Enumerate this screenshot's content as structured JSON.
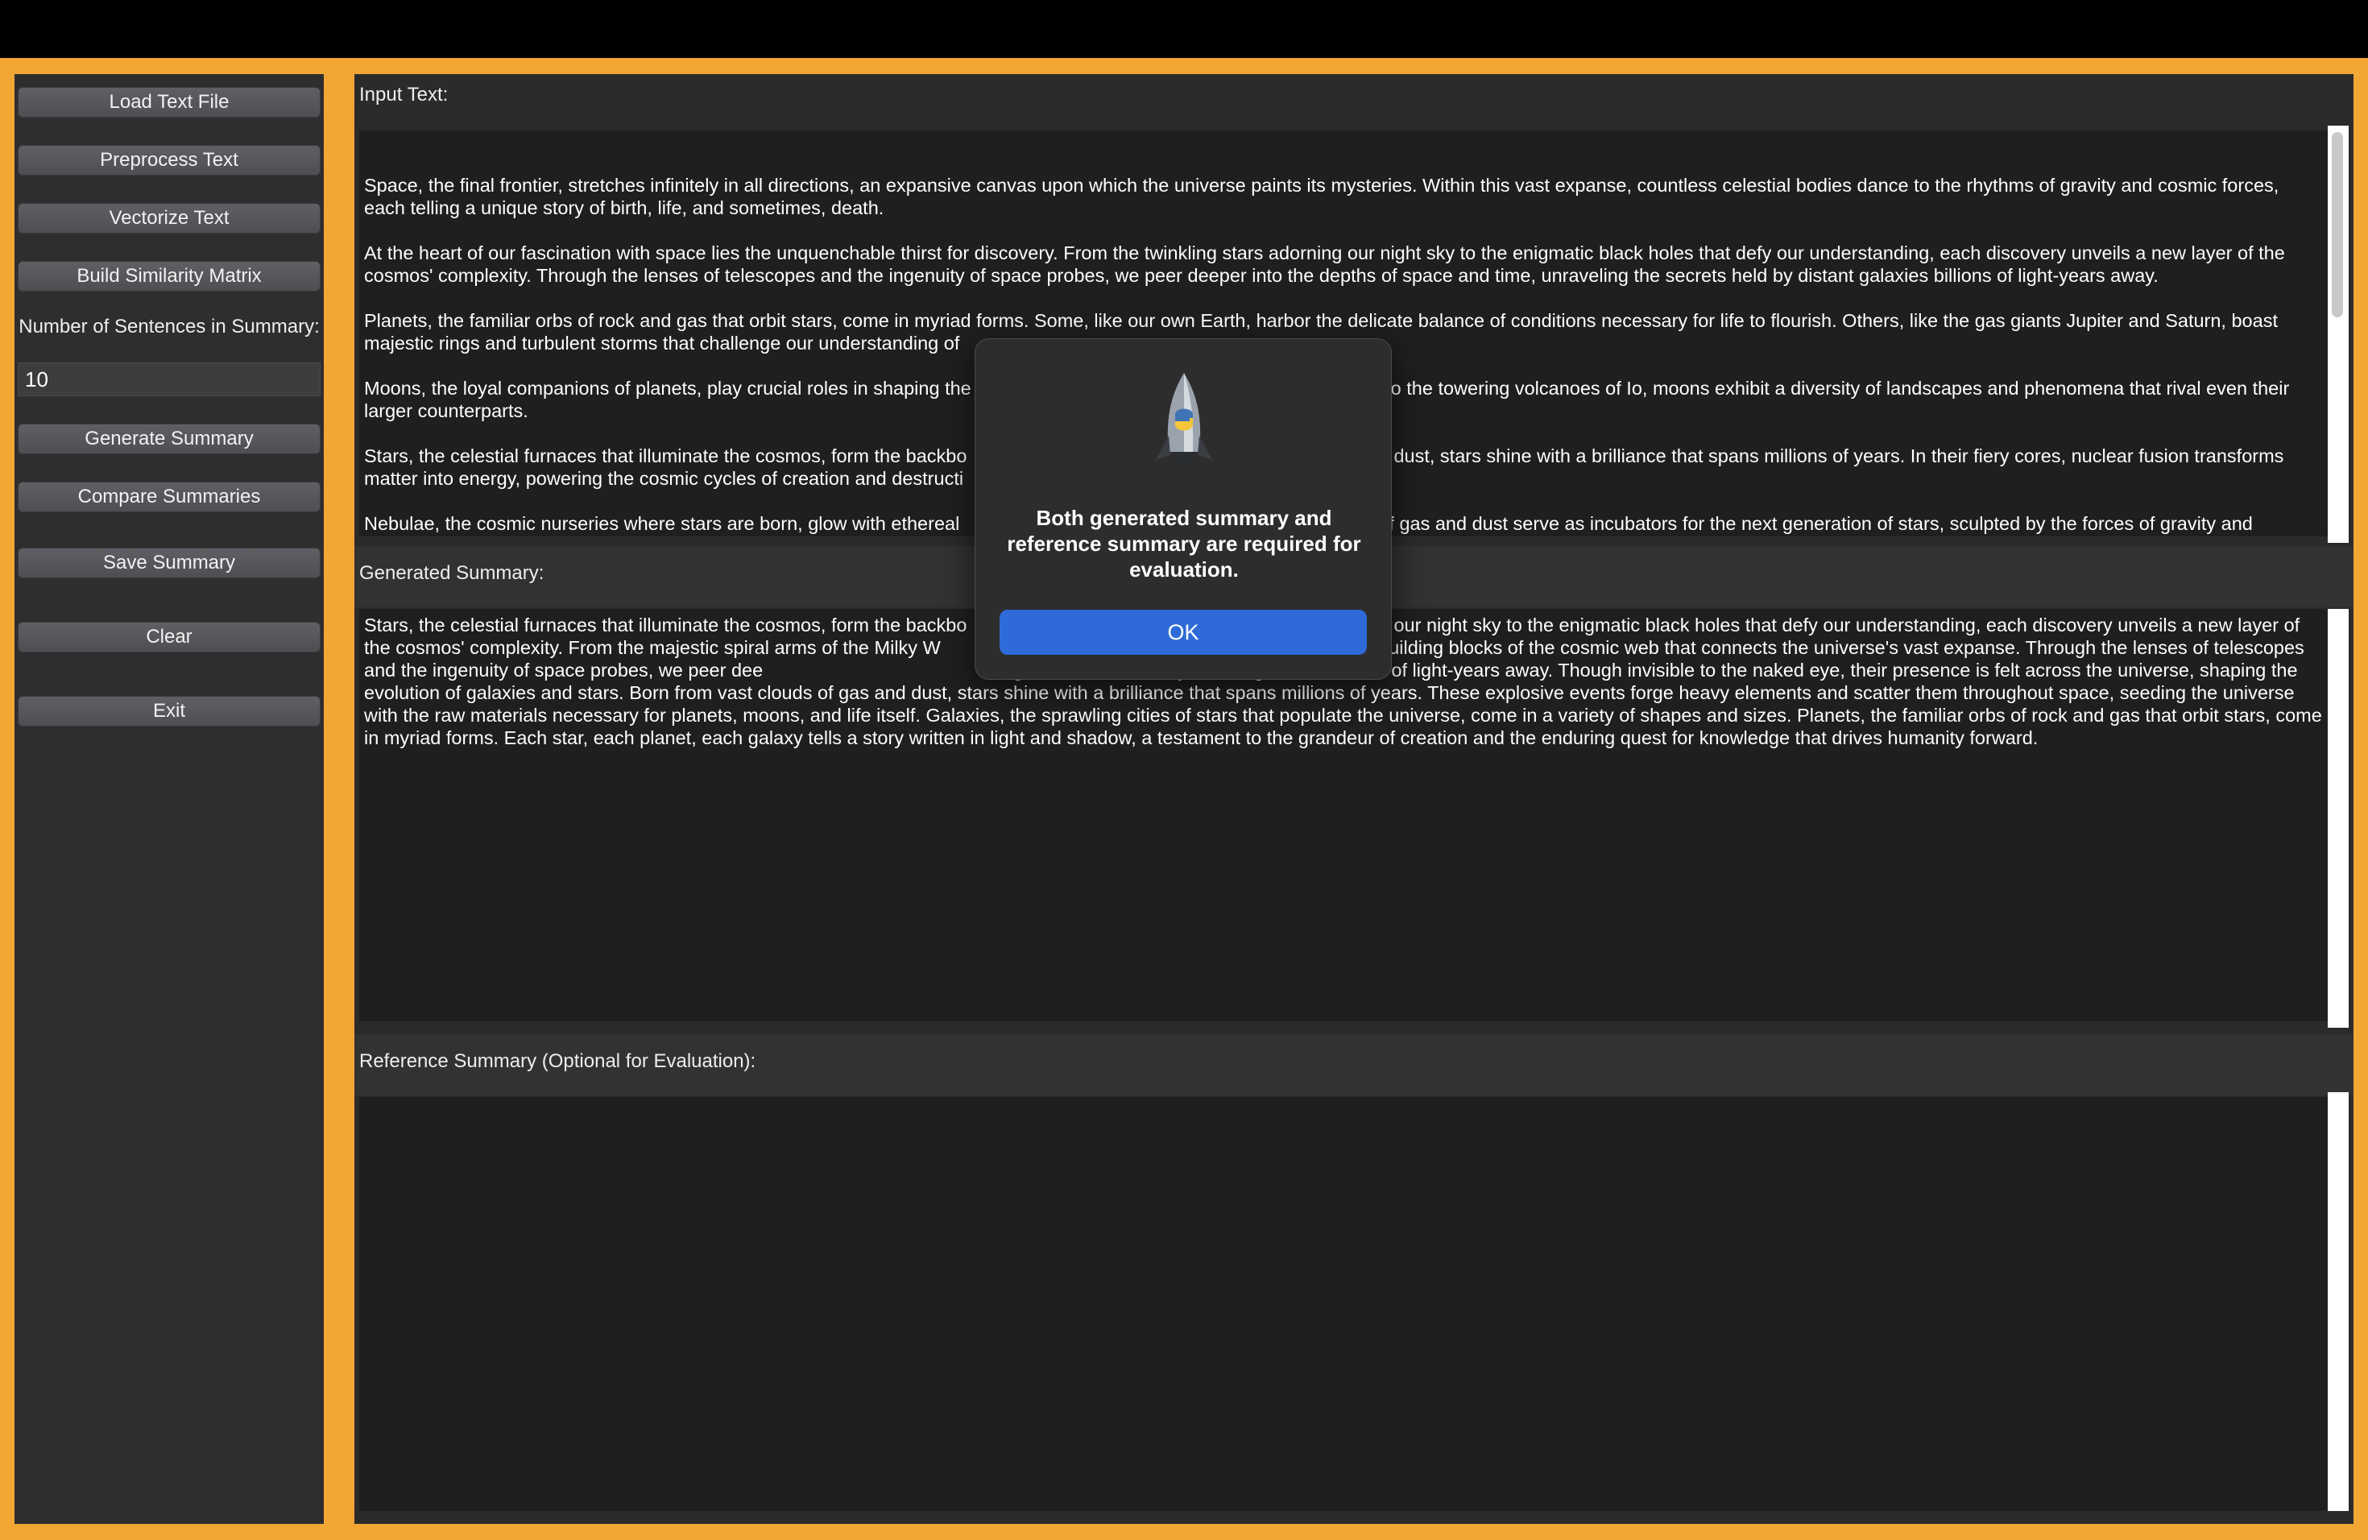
{
  "sidebar": {
    "buttons": {
      "load": "Load Text File",
      "preprocess": "Preprocess Text",
      "vectorize": "Vectorize Text",
      "similarity": "Build Similarity Matrix",
      "generate": "Generate Summary",
      "compare": "Compare Summaries",
      "save": "Save Summary",
      "clear": "Clear",
      "exit": "Exit"
    },
    "num_sentences_label": "Number of Sentences in Summary:",
    "num_sentences_value": "10"
  },
  "input": {
    "label": "Input Text:",
    "paragraphs": [
      "Space, the final frontier, stretches infinitely in all directions, an expansive canvas upon which the universe paints its mysteries. Within this vast expanse, countless celestial bodies dance to the rhythms of gravity and cosmic forces, each telling a unique story of birth, life, and sometimes, death.",
      "At the heart of our fascination with space lies the unquenchable thirst for discovery. From the twinkling stars adorning our night sky to the enigmatic black holes that defy our understanding, each discovery unveils a new layer of the cosmos' complexity. Through the lenses of telescopes and the ingenuity of space probes, we peer deeper into the depths of space and time, unraveling the secrets held by distant galaxies billions of light-years away.",
      "Planets, the familiar orbs of rock and gas that orbit stars, come in myriad forms. Some, like our own Earth, harbor the delicate balance of conditions necessary for life to flourish. Others, like the gas giants Jupiter and Saturn, boast majestic rings and turbulent storms that challenge our understanding of",
      "Moons, the loyal companions of planets, play crucial roles in shaping the",
      "dus to the towering volcanoes of Io, moons exhibit a diversity of landscapes and phenomena that rival even their larger counterparts.",
      "Stars, the celestial furnaces that illuminate the cosmos, form the backbo",
      "dust, stars shine with a brilliance that spans millions of years. In their fiery cores, nuclear fusion transforms matter into energy, powering the cosmic cycles of creation and destructi",
      "Nebulae, the cosmic nurseries where stars are born, glow with ethereal",
      "of gas and dust serve as incubators for the next generation of stars, sculpted by the forces of gravity and"
    ]
  },
  "generated": {
    "label": "Generated Summary:",
    "text_a": "Stars, the celestial furnaces that illuminate the cosmos, form the backbo",
    "text_b": "our night sky to the enigmatic black holes that defy our understanding, each discovery unveils a new layer of the cosmos' complexity. From the majestic spiral arms of the Milky W",
    "text_c": "ds, galaxies form the building blocks of the cosmic web that connects the universe's vast expanse. Through the lenses of telescopes and the ingenuity of space probes, we peer dee",
    "text_d": "g the secrets held by distant galaxies billions of light-years away. Though invisible to the naked eye, their presence is felt across the universe, shaping the evolution of galaxies and stars. Born from vast clouds of gas and dust, stars shine with a brilliance that spans millions of years. These explosive events forge heavy elements and scatter them throughout space, seeding the universe with the raw materials necessary for planets, moons, and life itself. Galaxies, the sprawling cities of stars that populate the universe, come in a variety of shapes and sizes. Planets, the familiar orbs of rock and gas that orbit stars, come in myriad forms. Each star, each planet, each galaxy tells a story written in light and shadow, a testament to the grandeur of creation and the enduring quest for knowledge that drives humanity forward."
  },
  "reference": {
    "label": "Reference Summary (Optional for Evaluation):",
    "text": ""
  },
  "dialog": {
    "message": "Both generated summary and reference summary are required for evaluation.",
    "ok_label": "OK",
    "icon": "python-rocket-icon"
  },
  "colors": {
    "window_border": "#F2A735",
    "sidebar_bg": "#2E2E2E",
    "textbox_bg": "#1F1F1F",
    "ok_button": "#2E6BD9"
  }
}
